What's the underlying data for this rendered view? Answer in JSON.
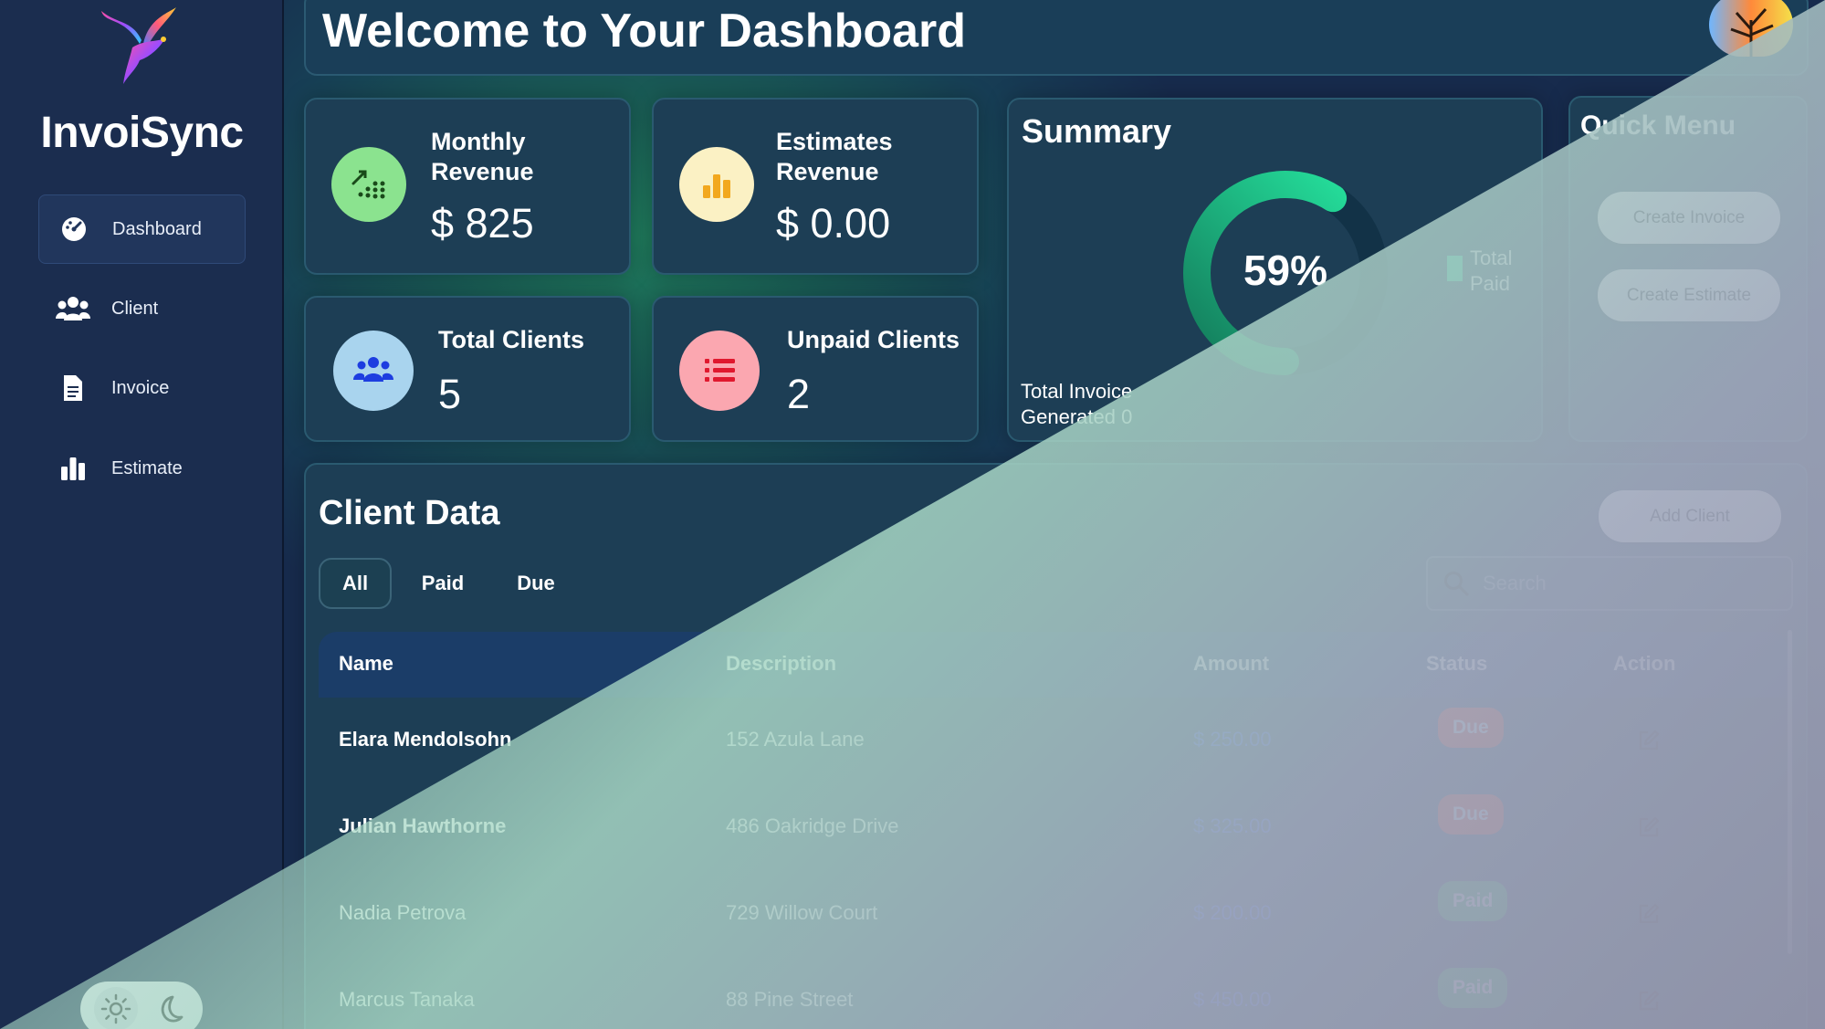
{
  "app": {
    "brand": "InvoiSync",
    "header_title": "Welcome to Your Dashboard"
  },
  "sidebar": {
    "items": [
      {
        "label": "Dashboard",
        "icon": "gauge-icon",
        "active": true
      },
      {
        "label": "Client",
        "icon": "users-icon"
      },
      {
        "label": "Invoice",
        "icon": "document-icon"
      },
      {
        "label": "Estimate",
        "icon": "bar-chart-icon"
      }
    ]
  },
  "stats": {
    "monthly_revenue": {
      "title_line1": "Monthly",
      "title_line2": "Revenue",
      "value": "$ 825",
      "icon_color": "#8be38f"
    },
    "estimates_revenue": {
      "title_line1": "Estimates",
      "title_line2": "Revenue",
      "value": "$ 0.00",
      "icon_color": "#fbf1c4"
    },
    "total_clients": {
      "title": "Total Clients",
      "value": "5",
      "icon_color": "#a9d4ee"
    },
    "unpaid_clients": {
      "title": "Unpaid Clients",
      "value": "2",
      "icon_color": "#fba7b0"
    }
  },
  "summary": {
    "title": "Summary",
    "percent_label": "59%",
    "percent": 59,
    "legend_line1": "Total",
    "legend_line2": "Paid",
    "footer_line1": "Total Invoice",
    "footer_line2": "Generated 0",
    "accent": "#1fe39a"
  },
  "quick_menu": {
    "title": "Quick Menu",
    "create_invoice": "Create Invoice",
    "create_estimate": "Create Estimate"
  },
  "client_data": {
    "title": "Client Data",
    "add_client": "Add Client",
    "filters": [
      "All",
      "Paid",
      "Due"
    ],
    "search_placeholder": "Search",
    "columns": [
      "Name",
      "Description",
      "Amount",
      "Status",
      "Action"
    ],
    "rows": [
      {
        "name": "Elara Mendolsohn",
        "description": "152 Azula Lane",
        "amount": "$ 250.00",
        "status": "Due"
      },
      {
        "name": "Julian Hawthorne",
        "description": "486 Oakridge Drive",
        "amount": "$ 325.00",
        "status": "Due"
      },
      {
        "name": "Nadia Petrova",
        "description": "729 Willow Court",
        "amount": "$ 200.00",
        "status": "Paid"
      },
      {
        "name": "Marcus Tanaka",
        "description": "88 Pine Street",
        "amount": "$ 450.00",
        "status": "Paid"
      }
    ]
  },
  "colors": {
    "due": "#f0401f",
    "paid": "#1fbf55",
    "amount": "#2f5cf0"
  }
}
